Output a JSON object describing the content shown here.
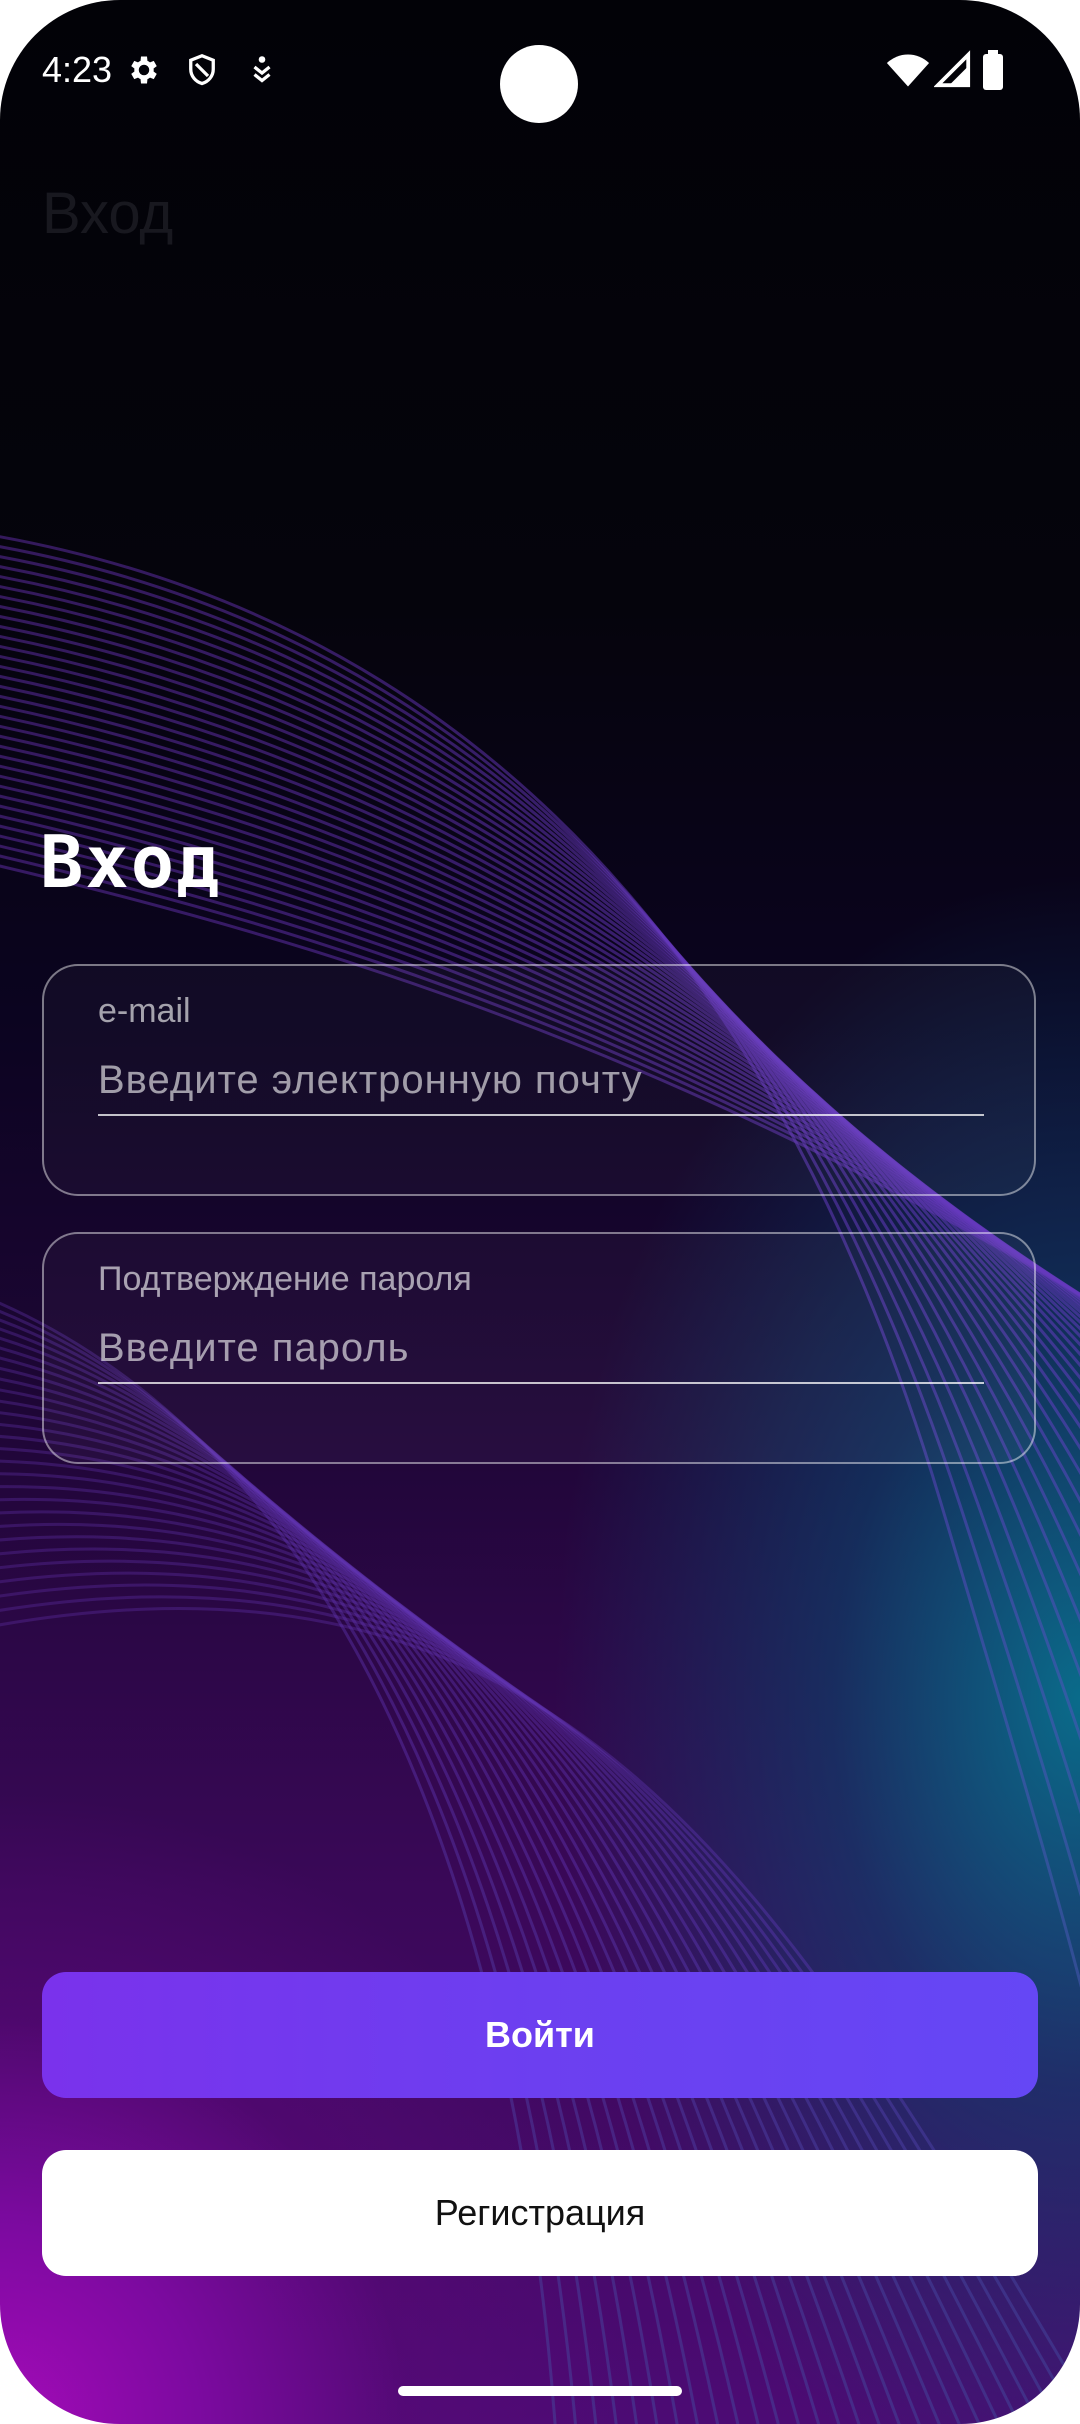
{
  "status_bar": {
    "time": "4:23",
    "left_icons": [
      "settings-gear-icon",
      "shield-icon",
      "download-person-icon"
    ],
    "right_icons": [
      "wifi-icon",
      "cellular-signal-icon",
      "battery-icon"
    ]
  },
  "app_bar": {
    "title": "Вход"
  },
  "login_form": {
    "title": "Вход",
    "email_field": {
      "label": "e-mail",
      "placeholder": "Введите электронную почту",
      "value": ""
    },
    "password_field": {
      "label": "Подтверждение пароля",
      "placeholder": "Введите пароль",
      "value": ""
    }
  },
  "actions": {
    "login_label": "Войти",
    "register_label": "Регистрация"
  },
  "colors": {
    "login_button": "#6c3ff0",
    "register_button": "#ffffff",
    "background_top": "#020207",
    "background_bottom_left": "#a40bb8",
    "background_right_accent": "#0a6b8a"
  }
}
